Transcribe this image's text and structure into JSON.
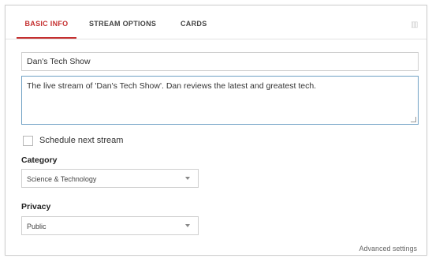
{
  "tabs": [
    {
      "label": "BASIC INFO",
      "active": true
    },
    {
      "label": "STREAM OPTIONS",
      "active": false
    },
    {
      "label": "CARDS",
      "active": false
    }
  ],
  "form": {
    "title_value": "Dan's Tech Show",
    "description_value": "The live stream of 'Dan's Tech Show'.  Dan reviews the latest and greatest tech.",
    "schedule_label": "Schedule next stream",
    "schedule_checked": false,
    "category_label": "Category",
    "category_value": "Science & Technology",
    "privacy_label": "Privacy",
    "privacy_value": "Public",
    "advanced_link": "Advanced settings"
  },
  "colors": {
    "accent": "#c53030",
    "focus_border": "#6fa0c4"
  }
}
